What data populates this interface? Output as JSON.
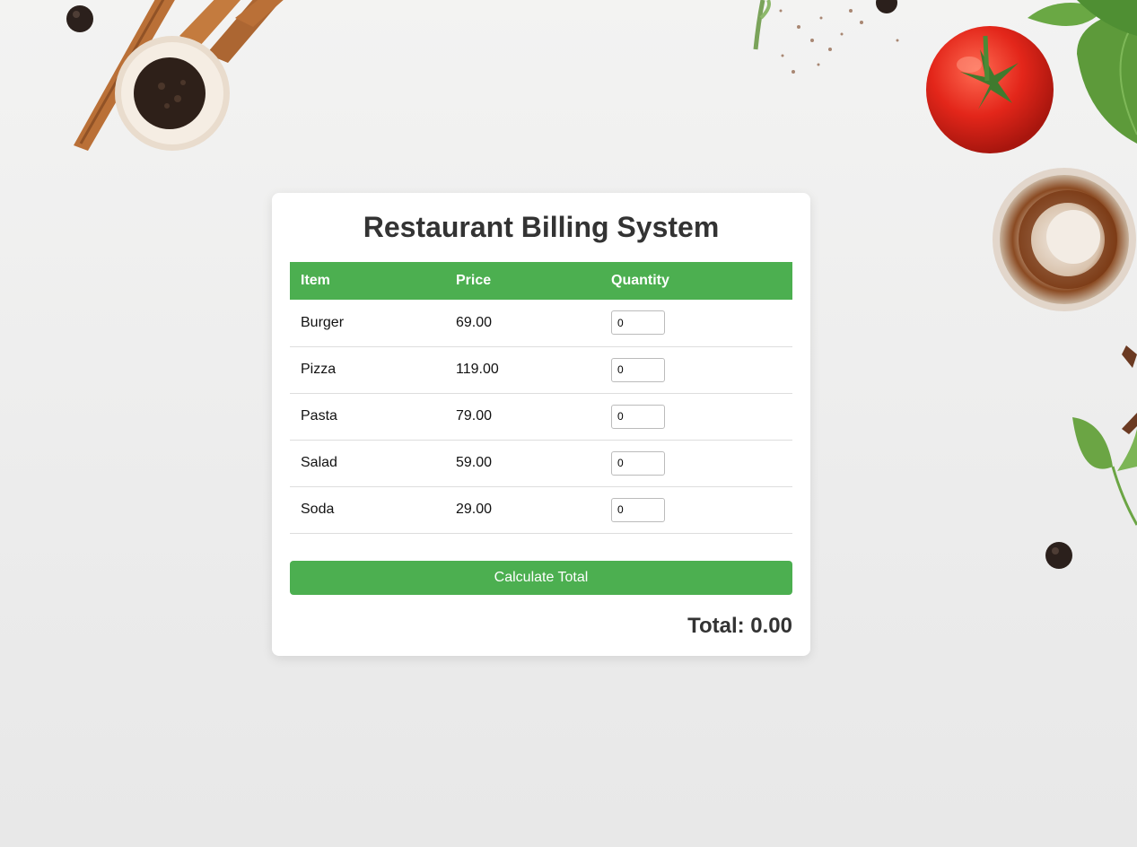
{
  "app": {
    "title": "Restaurant Billing System"
  },
  "table": {
    "headers": [
      "Item",
      "Price",
      "Quantity"
    ],
    "rows": [
      {
        "item": "Burger",
        "price": "69.00",
        "quantity": "0"
      },
      {
        "item": "Pizza",
        "price": "119.00",
        "quantity": "0"
      },
      {
        "item": "Pasta",
        "price": "79.00",
        "quantity": "0"
      },
      {
        "item": "Salad",
        "price": "59.00",
        "quantity": "0"
      },
      {
        "item": "Soda",
        "price": "29.00",
        "quantity": "0"
      }
    ]
  },
  "actions": {
    "calculate_label": "Calculate Total"
  },
  "summary": {
    "total_label": "Total:",
    "total_value": "0.00"
  },
  "colors": {
    "accent": "#4caf50",
    "heading_text": "#333333",
    "card_bg": "#ffffff"
  }
}
